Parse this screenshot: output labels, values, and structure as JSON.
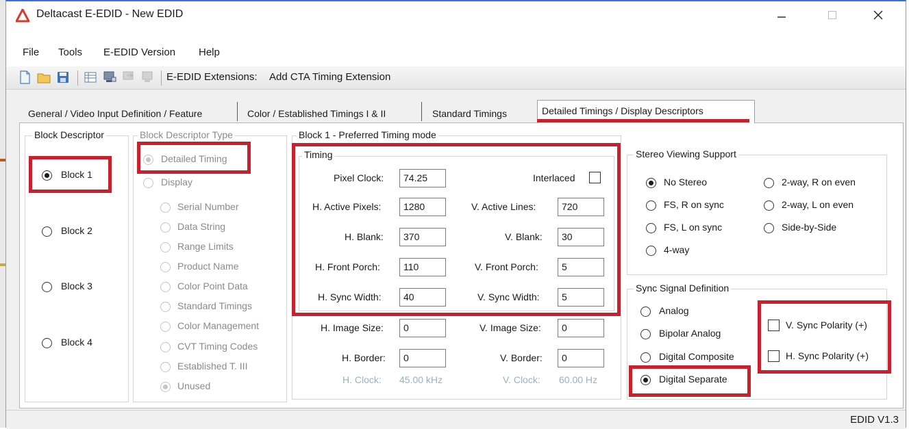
{
  "window": {
    "title": "Deltacast E-EDID - New EDID",
    "minimize_icon": "minimize-icon",
    "maximize_icon": "maximize-icon",
    "close_icon": "close-icon"
  },
  "menu": {
    "items": [
      "File",
      "Tools",
      "E-EDID Version",
      "Help"
    ]
  },
  "toolbar": {
    "icons": [
      "new-file-icon",
      "open-folder-icon",
      "save-icon",
      "table-icon",
      "monitor-icon",
      "disabled-monitor-icon",
      "disabled-monitor-2-icon"
    ],
    "extensions_label": "E-EDID Extensions:",
    "extensions_action": "Add CTA Timing Extension"
  },
  "tabs": [
    {
      "label": "General / Video Input Definition / Feature"
    },
    {
      "label": "Color / Established Timings I & II"
    },
    {
      "label": "Standard Timings"
    },
    {
      "label": "Detailed Timings / Display Descriptors"
    }
  ],
  "block_descriptor": {
    "title": "Block Descriptor",
    "blocks": [
      "Block 1",
      "Block 2",
      "Block 3",
      "Block 4"
    ],
    "selected": "Block 1"
  },
  "block_type": {
    "title": "Block Descriptor Type",
    "detailed": "Detailed Timing",
    "display": "Display",
    "display_options": [
      "Serial Number",
      "Data String",
      "Range Limits",
      "Product Name",
      "Color Point Data",
      "Standard Timings",
      "Color Management",
      "CVT Timing Codes",
      "Established T. III",
      "Unused"
    ]
  },
  "timing_group": {
    "title": "Block 1 -  Preferred Timing mode",
    "sub_title": "Timing",
    "pixel_clock_label": "Pixel Clock:",
    "pixel_clock": "74.25",
    "interlaced_label": "Interlaced",
    "h_active_label": "H. Active Pixels:",
    "h_active": "1280",
    "v_active_label": "V. Active Lines:",
    "v_active": "720",
    "h_blank_label": "H. Blank:",
    "h_blank": "370",
    "v_blank_label": "V. Blank:",
    "v_blank": "30",
    "h_front_label": "H. Front Porch:",
    "h_front": "110",
    "v_front_label": "V. Front Porch:",
    "v_front": "5",
    "h_sync_label": "H. Sync Width:",
    "h_sync": "40",
    "v_sync_label": "V. Sync Width:",
    "v_sync": "5",
    "h_image_label": "H. Image Size:",
    "h_image": "0",
    "v_image_label": "V. Image Size:",
    "v_image": "0",
    "h_border_label": "H. Border:",
    "h_border": "0",
    "v_border_label": "V. Border:",
    "v_border": "0",
    "h_clock_label": "H. Clock:",
    "h_clock": "45.00 kHz",
    "v_clock_label": "V. Clock:",
    "v_clock": "60.00 Hz"
  },
  "stereo": {
    "title": "Stereo Viewing Support",
    "options_left": [
      "No Stereo",
      "FS, R on sync",
      "FS, L on sync",
      "4-way"
    ],
    "options_right": [
      "2-way, R on even",
      "2-way, L on even",
      "Side-by-Side"
    ],
    "selected": "No Stereo"
  },
  "sync": {
    "title": "Sync Signal Definition",
    "options": [
      "Analog",
      "Bipolar Analog",
      "Digital Composite",
      "Digital Separate"
    ],
    "selected": "Digital Separate",
    "v_polarity": "V. Sync Polarity (+)",
    "h_polarity": "H. Sync Polarity (+)"
  },
  "status": {
    "version": "EDID V1.3"
  },
  "colors": {
    "highlight": "#c8202c",
    "accent": "#3a6fd8"
  }
}
